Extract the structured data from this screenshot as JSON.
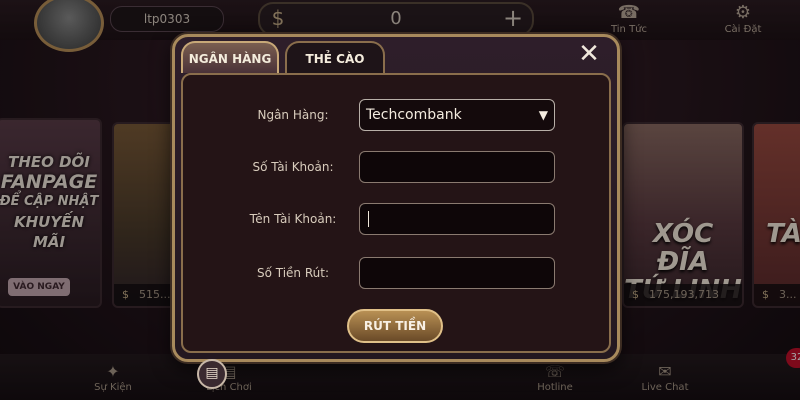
{
  "header": {
    "username": "ltp0303",
    "balance": "0",
    "coin_icon": "$",
    "plus_icon": "+",
    "menu": [
      {
        "icon": "phone-icon",
        "glyph": "☎",
        "label": "Tin Tức"
      },
      {
        "icon": "gear-icon",
        "glyph": "⚙",
        "label": "Cài Đặt"
      }
    ]
  },
  "lobby": {
    "promo": {
      "text_lines": [
        "THEO DÕI",
        "FANPAGE",
        "ĐỂ CẬP NHẬT",
        "KHUYẾN MÃI"
      ],
      "button": "VÀO NGAY"
    },
    "cards": [
      {
        "money": "515..."
      },
      {
        "title_lines": [
          "XÓC ĐĨA",
          "TỨ LINH"
        ],
        "money": "175,193,713"
      },
      {
        "title_lines": [
          "TÀ"
        ],
        "money": "3..."
      }
    ]
  },
  "bottom_nav": [
    {
      "icon": "event-icon",
      "glyph": "✦",
      "label": "Sự Kiện"
    },
    {
      "icon": "history-icon",
      "glyph": "▤",
      "label": "Lịch Chơi"
    },
    {
      "icon": "hotline-icon",
      "glyph": "☏",
      "label": "Hotline"
    },
    {
      "icon": "chat-icon",
      "glyph": "✉",
      "label": "Live Chat"
    }
  ],
  "badge_count": "32",
  "dialog": {
    "tabs": {
      "bank": "NGÂN HÀNG",
      "card": "THẺ CÀO"
    },
    "close_glyph": "✕",
    "fields": {
      "bank_label": "Ngân Hàng:",
      "bank_value": "Techcombank",
      "account_number_label": "Số Tài Khoản:",
      "account_number_value": "",
      "account_name_label": "Tên Tài Khoản:",
      "account_name_value": "",
      "amount_label": "Số Tiền Rút:",
      "amount_value": ""
    },
    "withdraw_button": "RÚT TIỀN",
    "history_glyph": "▤"
  }
}
